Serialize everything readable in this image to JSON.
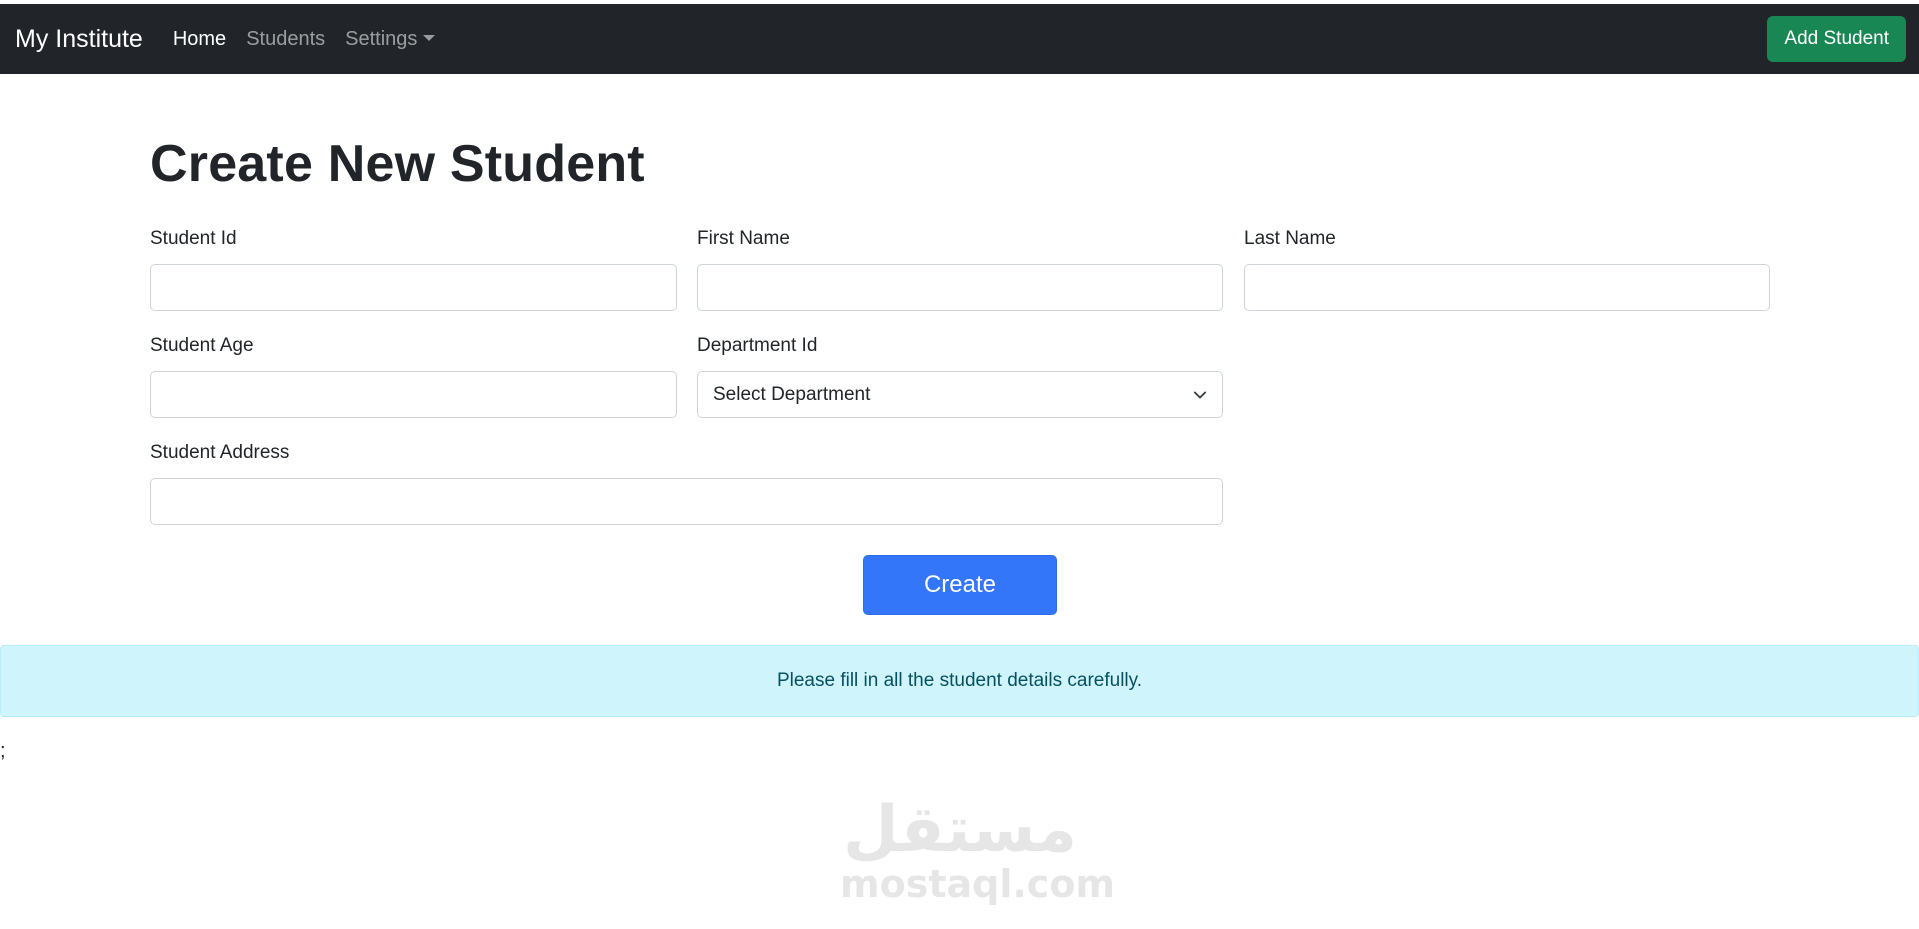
{
  "navbar": {
    "brand": "My Institute",
    "links": [
      {
        "label": "Home"
      },
      {
        "label": "Students"
      },
      {
        "label": "Settings"
      }
    ],
    "add_button": "Add Student"
  },
  "page": {
    "title": "Create New Student"
  },
  "form": {
    "student_id": {
      "label": "Student Id",
      "value": ""
    },
    "first_name": {
      "label": "First Name",
      "value": ""
    },
    "last_name": {
      "label": "Last Name",
      "value": ""
    },
    "student_age": {
      "label": "Student Age",
      "value": ""
    },
    "department_id": {
      "label": "Department Id",
      "selected": "Select Department"
    },
    "student_address": {
      "label": "Student Address",
      "value": ""
    },
    "submit": "Create"
  },
  "alert": {
    "message": "Please fill in all the student details carefully."
  },
  "stray_text": ";",
  "watermark": {
    "arabic": "مستقل",
    "latin": "mostaql.com"
  },
  "colors": {
    "navbar": "#212529",
    "add_button": "#198754",
    "create_button": "#3476f9",
    "alert_bg": "#cff4fc",
    "alert_text": "#055160"
  }
}
